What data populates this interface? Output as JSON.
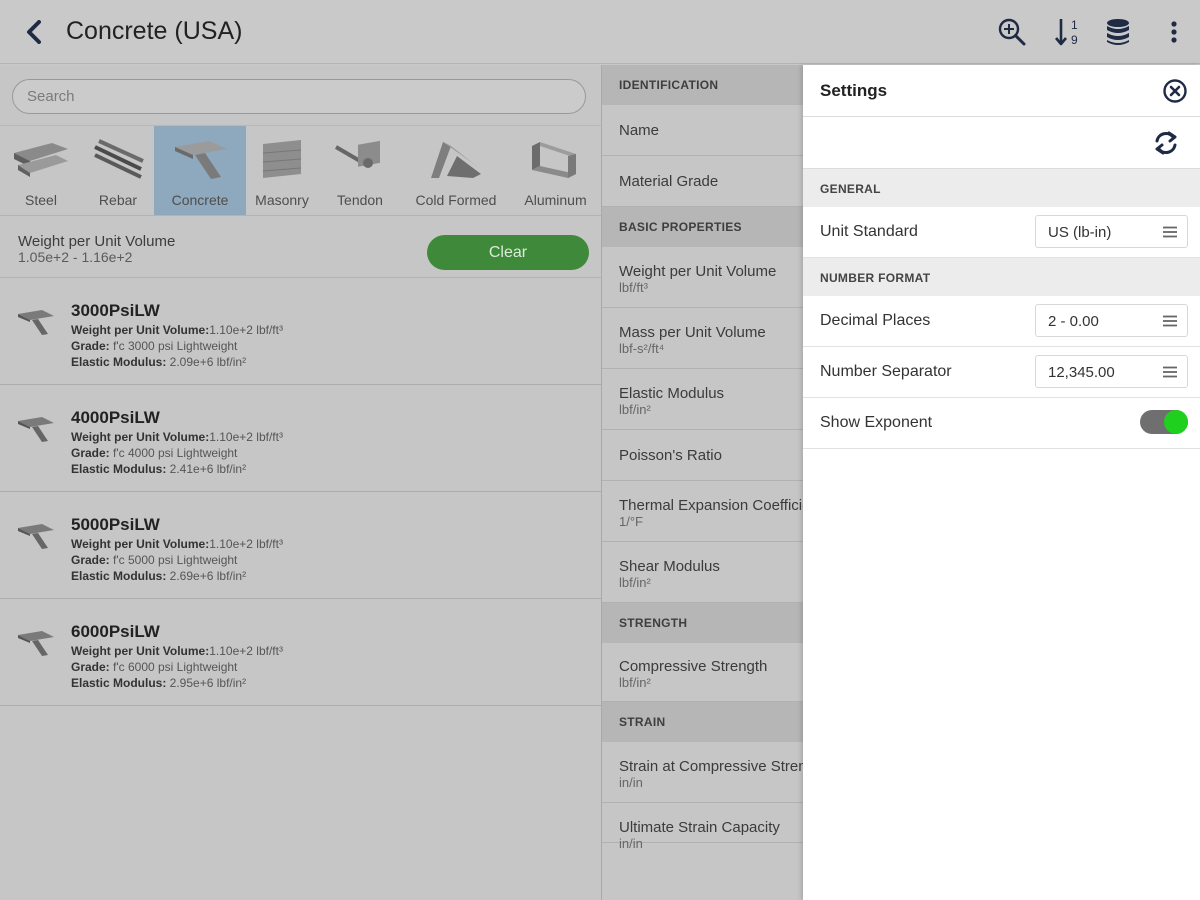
{
  "header": {
    "title": "Concrete (USA)",
    "icons": [
      "back-chevron-icon",
      "search-zoom-icon",
      "sort-numeric-icon",
      "database-icon",
      "more-vert-icon"
    ]
  },
  "search": {
    "placeholder": "Search"
  },
  "categories": [
    {
      "label": "Steel",
      "active": false
    },
    {
      "label": "Rebar",
      "active": false
    },
    {
      "label": "Concrete",
      "active": true
    },
    {
      "label": "Masonry",
      "active": false
    },
    {
      "label": "Tendon",
      "active": false
    },
    {
      "label": "Cold Formed",
      "active": false
    },
    {
      "label": "Aluminum",
      "active": false
    }
  ],
  "filter": {
    "label": "Weight per Unit Volume",
    "range": "1.05e+2 - 1.16e+2",
    "clear_label": "Clear"
  },
  "items": [
    {
      "name": "3000PsiLW",
      "weight_key": "Weight per Unit Volume:",
      "weight_val": "1.10e+2 lbf/ft³",
      "grade_key": "Grade:",
      "grade_val": " f'c 3000 psi Lightweight",
      "modulus_key": "Elastic Modulus:",
      "modulus_val": " 2.09e+6 lbf/in²"
    },
    {
      "name": "4000PsiLW",
      "weight_key": "Weight per Unit Volume:",
      "weight_val": "1.10e+2 lbf/ft³",
      "grade_key": "Grade:",
      "grade_val": " f'c 4000 psi Lightweight",
      "modulus_key": "Elastic Modulus:",
      "modulus_val": " 2.41e+6 lbf/in²"
    },
    {
      "name": "5000PsiLW",
      "weight_key": "Weight per Unit Volume:",
      "weight_val": "1.10e+2 lbf/ft³",
      "grade_key": "Grade:",
      "grade_val": " f'c 5000 psi Lightweight",
      "modulus_key": "Elastic Modulus:",
      "modulus_val": " 2.69e+6 lbf/in²"
    },
    {
      "name": "6000PsiLW",
      "weight_key": "Weight per Unit Volume:",
      "weight_val": "1.10e+2 lbf/ft³",
      "grade_key": "Grade:",
      "grade_val": " f'c 6000 psi Lightweight",
      "modulus_key": "Elastic Modulus:",
      "modulus_val": " 2.95e+6 lbf/in²"
    }
  ],
  "properties": {
    "identification": "IDENTIFICATION",
    "name": "Name",
    "material_grade": "Material Grade",
    "basic": "BASIC PROPERTIES",
    "weight": "Weight per Unit Volume",
    "weight_unit": "lbf/ft³",
    "mass": "Mass per Unit Volume",
    "mass_unit": "lbf-s²/ft⁴",
    "elastic": "Elastic Modulus",
    "elastic_unit": "lbf/in²",
    "poisson": "Poisson's Ratio",
    "thermal": "Thermal Expansion Coefficient",
    "thermal_unit": "1/°F",
    "shear": "Shear Modulus",
    "shear_unit": "lbf/in²",
    "strength": "STRENGTH",
    "compressive": "Compressive Strength",
    "compressive_unit": "lbf/in²",
    "strain": "STRAIN",
    "strain_comp": "Strain at Compressive Strength",
    "strain_comp_unit": "in/in",
    "ultimate": "Ultimate Strain Capacity",
    "ultimate_unit": "in/in"
  },
  "settings": {
    "title": "Settings",
    "general": "GENERAL",
    "unit_standard_label": "Unit Standard",
    "unit_standard_value": "US (lb-in)",
    "number_format": "NUMBER FORMAT",
    "decimal_label": "Decimal Places",
    "decimal_value": "2 - 0.00",
    "separator_label": "Number Separator",
    "separator_value": "12,345.00",
    "exponent_label": "Show Exponent",
    "exponent_on": true
  },
  "colors": {
    "accent_green": "#3f8a3a",
    "toggle_green": "#1fd01f",
    "active_category": "#8ea8bd",
    "icon_navy": "#1f2a44"
  }
}
